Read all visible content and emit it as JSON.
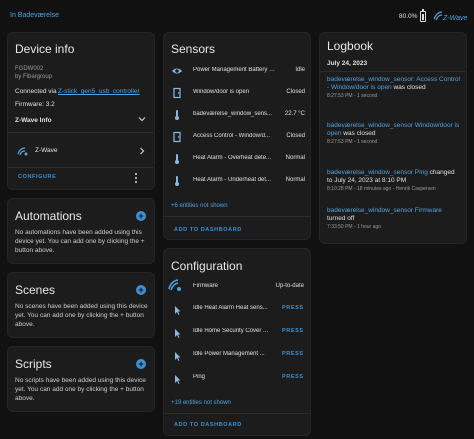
{
  "topbar": {
    "title": "In Badeværelse",
    "battery": "80.0%",
    "brand_name": "Z-Wave"
  },
  "device_info": {
    "title": "Device info",
    "model": "FGDW002",
    "manufacturer": "by Fibargroup",
    "connected_prefix": "Connected via",
    "connected_link": "Z-stick_gen5_usb_controller",
    "firmware": "Firmware: 3.2",
    "zwave_info": "Z-Wave Info",
    "zwave_label": "Z-Wave",
    "configure": "CONFIGURE"
  },
  "automations": {
    "title": "Automations",
    "text": "No automations have been added using this device yet. You can add one by clicking the + button above."
  },
  "scenes": {
    "title": "Scenes",
    "text": "No scenes have been added using this device yet. You can add one by clicking the + button above."
  },
  "scripts": {
    "title": "Scripts",
    "text": "No scripts have been added using this device yet. You can add one by clicking the + button above."
  },
  "sensors": {
    "title": "Sensors",
    "rows": [
      {
        "name": "Power Management Battery ma...",
        "state": "Idle",
        "icon": "eye-icon"
      },
      {
        "name": "Window/door is open",
        "state": "Closed",
        "icon": "door-icon"
      },
      {
        "name": "badeværelse_window_sens...",
        "state": "22.7 °C",
        "icon": "thermometer-icon"
      },
      {
        "name": "Access Control - Window/d...",
        "state": "Closed",
        "icon": "door-icon"
      },
      {
        "name": "Heat Alarm - Overheat dete...",
        "state": "Normal",
        "icon": "thermometer-icon"
      },
      {
        "name": "Heat Alarm - Underheat det...",
        "state": "Normal",
        "icon": "thermometer-icon"
      }
    ],
    "hidden": "+6 entities not shown",
    "add": "ADD TO DASHBOARD"
  },
  "configuration": {
    "title": "Configuration",
    "firmware_name": "Firmware",
    "firmware_state": "Up-to-date",
    "rows": [
      {
        "name": "Idle Heat Alarm Heat sens...",
        "action": "PRESS"
      },
      {
        "name": "Idle Home Security Cover ...",
        "action": "PRESS"
      },
      {
        "name": "Idle Power Management ...",
        "action": "PRESS"
      },
      {
        "name": "Ping",
        "action": "PRESS"
      }
    ],
    "hidden": "+19 entities not shown",
    "add": "ADD TO DASHBOARD"
  },
  "logbook": {
    "title": "Logbook",
    "date": "July 24, 2023",
    "entries": [
      {
        "link": "badeværelse_window_sensor: Access Control - Window/door is open",
        "text": "was closed",
        "meta": "8:27:53 PM - 1 second"
      },
      {
        "link": "badeværelse_window_sensor Window/door is open",
        "text": "was closed",
        "meta": "8:27:53 PM - 1 second"
      },
      {
        "link": "badeværelse_window_sensor Ping",
        "text": "changed to July 24, 2023 at 8:10 PM",
        "meta": "8:10:28 PM - 18 minutes ago - Henrik Caspersen"
      },
      {
        "link": "badeværelse_window_sensor Firmware",
        "text": "turned off",
        "meta": "7:33:50 PM - 1 hour ago"
      }
    ]
  },
  "colors": {
    "accent": "#3d8fd1",
    "background": "#111111",
    "card": "#1c1c1c"
  }
}
